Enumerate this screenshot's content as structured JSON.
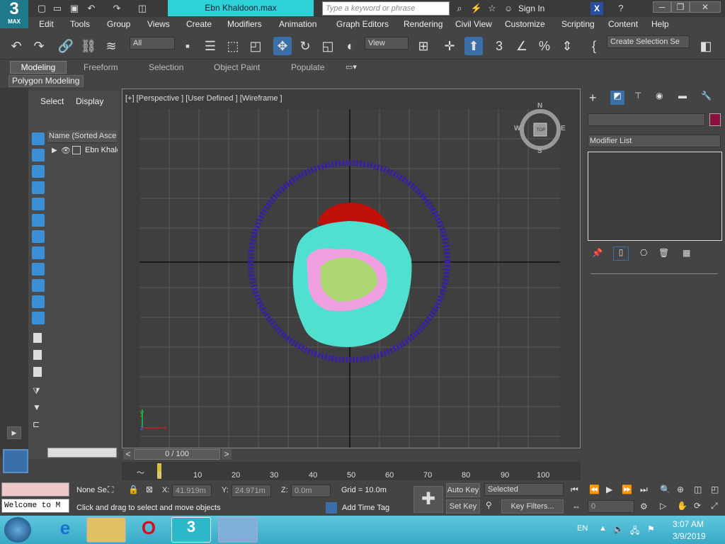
{
  "app": {
    "logo_number": "3",
    "logo_label": "MAX",
    "title": "Ebn Khaldoon.max"
  },
  "search": {
    "placeholder": "Type a keyword or phrase"
  },
  "account": {
    "signin": "Sign In"
  },
  "menus": [
    "Edit",
    "Tools",
    "Group",
    "Views",
    "Create",
    "Modifiers",
    "Animation",
    "Graph Editors",
    "Rendering",
    "Civil View",
    "Customize",
    "Scripting",
    "Content",
    "Help"
  ],
  "toolbar": {
    "filter": "All",
    "refcoord": "View",
    "selection_set": "Create Selection Se"
  },
  "ribbon": {
    "tabs": [
      "Modeling",
      "Freeform",
      "Selection",
      "Object Paint",
      "Populate"
    ],
    "panel": "Polygon Modeling"
  },
  "scene": {
    "tabs": [
      "Select",
      "Display"
    ],
    "column": "Name (Sorted Ascer",
    "item": "Ebn Khald"
  },
  "viewport": {
    "label": "[+] [Perspective ] [User Defined ] [Wireframe ]",
    "compass": {
      "n": "N",
      "s": "S",
      "e": "E",
      "w": "W",
      "cube": "TOP"
    }
  },
  "command": {
    "modifier_list": "Modifier List",
    "object_color": "#8a1040"
  },
  "timeline": {
    "frame": "0 / 100",
    "ticks": [
      "0",
      "10",
      "20",
      "30",
      "40",
      "50",
      "60",
      "70",
      "80",
      "90",
      "100"
    ]
  },
  "status": {
    "maxscript": "Welcome to M",
    "selected": "None Se",
    "x_label": "X:",
    "x": "41.919m",
    "y_label": "Y:",
    "y": "24.971m",
    "z_label": "Z:",
    "z": "0.0m",
    "grid": "Grid = 10.0m",
    "prompt": "Click and drag to select and move objects",
    "add_time_tag": "Add Time Tag",
    "auto_key": "Auto Key",
    "set_key": "Set Key",
    "key_mode": "Selected",
    "key_filters": "Key Filters...",
    "frame_field": "0"
  },
  "tray": {
    "lang": "EN",
    "time": "3:07 AM",
    "date": "3/9/2019"
  },
  "colors": {
    "accent": "#2dd1d6",
    "wire_blue": "#3a1fa0",
    "wire_cyan": "#4fe0d0",
    "wire_red": "#c0100a",
    "wire_pink": "#f0a0e0",
    "wire_green": "#a0e060"
  }
}
